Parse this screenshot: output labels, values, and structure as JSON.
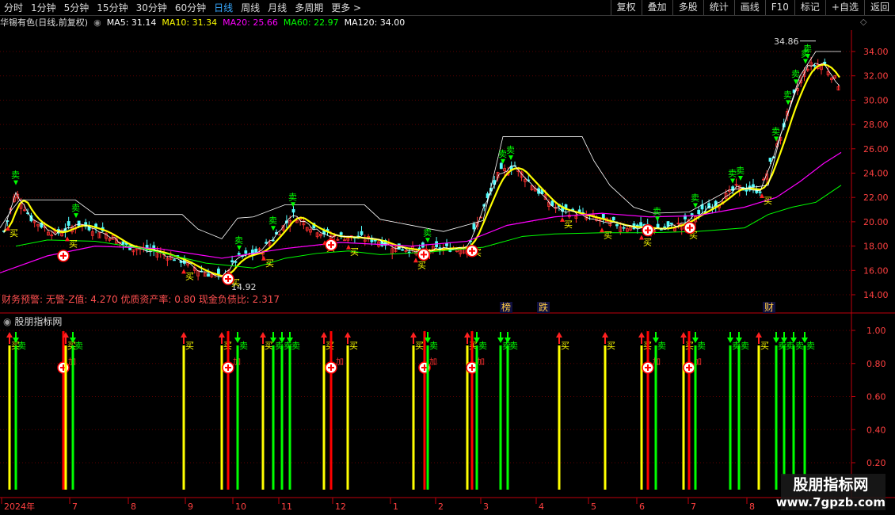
{
  "toolbar": {
    "periods": [
      "分时",
      "1分钟",
      "5分钟",
      "15分钟",
      "30分钟",
      "60分钟",
      "日线",
      "周线",
      "月线",
      "多周期",
      "更多 >"
    ],
    "active_period": "日线",
    "tools": [
      "复权",
      "叠加",
      "多股",
      "统计",
      "画线",
      "F10",
      "标记",
      "+自选",
      "返回"
    ]
  },
  "info": {
    "stock_title": "华锡有色(日线,前复权)",
    "ma5": "MA5: 31.14",
    "ma10": "MA10: 31.34",
    "ma20": "MA20: 25.66",
    "ma60": "MA60: 22.97",
    "ma120": "MA120: 34.00"
  },
  "colors": {
    "ma5": "#ffffff",
    "ma10": "#ffff00",
    "ma20": "#ff00ff",
    "ma60": "#00ff00",
    "ma120": "#ffffff",
    "buy": "#ffff00",
    "sell": "#00ff00",
    "add": "#ff0000",
    "axis": "#c0000b"
  },
  "main_chart": {
    "price_axis": [
      "34.00",
      "32.00",
      "30.00",
      "28.00",
      "26.00",
      "24.00",
      "22.00",
      "20.00",
      "18.00",
      "16.00",
      "14.00"
    ],
    "high_label": "34.86",
    "low_label": "14.92",
    "financial_text": "财务预警: 无警-Z值: 4.270 优质资产率: 0.80 现金负债比: 2.317",
    "event_tags": [
      "榜",
      "跌",
      "财"
    ]
  },
  "sub_chart": {
    "title": "股朋指标网",
    "axis": [
      "1.00",
      "0.80",
      "0.60",
      "0.40",
      "0.20"
    ],
    "buy_label": "买",
    "sell_label": "卖",
    "add_label": "加"
  },
  "date_axis": [
    "2024年",
    "7",
    "8",
    "9",
    "10",
    "11",
    "12",
    "1",
    "2",
    "3",
    "4",
    "5",
    "6",
    "7",
    "8"
  ],
  "watermark": {
    "name": "股朋指标网",
    "url": "www.7gpzb.com"
  }
}
